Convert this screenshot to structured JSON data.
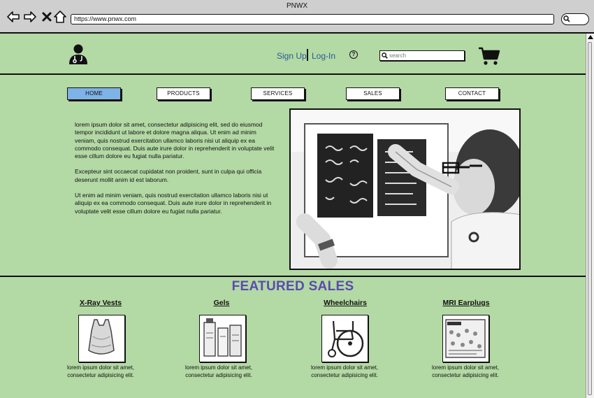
{
  "browser": {
    "title": "PNWX",
    "url": "https://www.pnwx.com"
  },
  "header": {
    "sign_up": "Sign Up",
    "log_in": "Log-In",
    "help_symbol": "?",
    "search_placeholder": "search",
    "cart_icon": "shopping-cart"
  },
  "nav": {
    "tabs": [
      {
        "label": "HOME",
        "active": true
      },
      {
        "label": "PRODUCTS",
        "active": false
      },
      {
        "label": "SERVICES",
        "active": false
      },
      {
        "label": "SALES",
        "active": false
      },
      {
        "label": "CONTACT",
        "active": false
      }
    ]
  },
  "intro": {
    "paragraphs": [
      "lorem ipsum dolor sit amet, consectetur adipisicing elit, sed do eiusmod tempor incididunt ut labore et dolore magna aliqua. Ut enim ad minim veniam, quis nostrud exercitation ullamco laboris nisi ut aliquip ex ea commodo consequat. Duis aute irure dolor in reprehenderit in voluptate velit esse cillum dolore eu fugiat nulla pariatur.",
      "Excepteur sint occaecat cupidatat non proident, sunt in culpa qui officia deserunt mollit anim id est laborum.",
      "Ut enim ad minim veniam, quis nostrud exercitation ullamco laboris nisi ut aliquip ex ea commodo consequat. Duis aute irure dolor in reprehenderit in voluptate velit esse cillum dolore eu fugiat nulla pariatur."
    ]
  },
  "featured": {
    "title": "FEATURED SALES",
    "products": [
      {
        "name": "X-Ray Vests",
        "description": "lorem ipsum dolor sit amet, consectetur adipisicing elit."
      },
      {
        "name": "Gels",
        "description": "lorem ipsum dolor sit amet, consectetur adipisicing elit."
      },
      {
        "name": "Wheelchairs",
        "description": "lorem ipsum dolor sit amet, consectetur adipisicing elit."
      },
      {
        "name": "MRI Earplugs",
        "description": "lorem ipsum dolor sit amet, consectetur adipisicing elit."
      }
    ]
  },
  "colors": {
    "page_background": "#b3d9a4",
    "active_tab": "#7fb2e6",
    "link": "#2a5a9a",
    "featured_title": "#5b4ab0"
  }
}
